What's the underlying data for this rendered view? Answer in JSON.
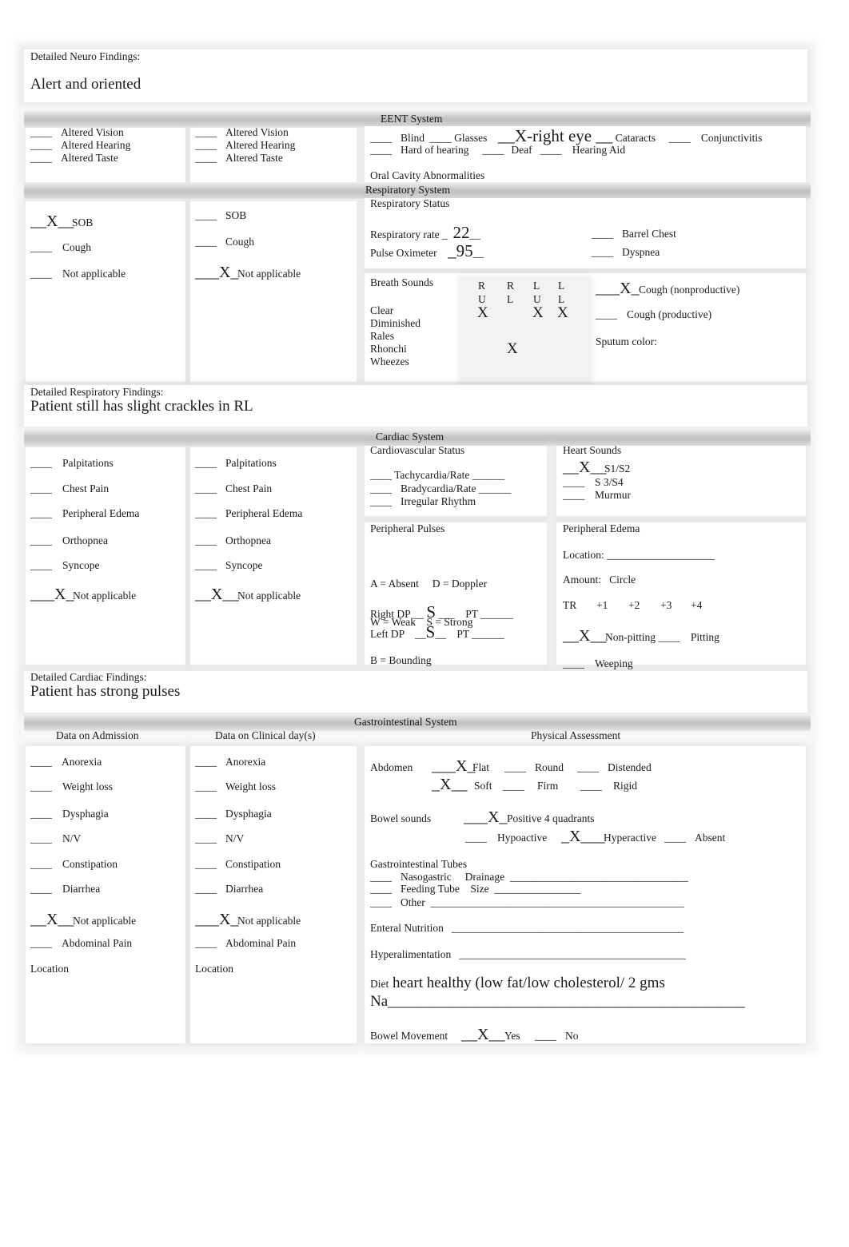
{
  "neuro": {
    "label": "Detailed Neuro Findings:",
    "value": "Alert and oriented"
  },
  "eent": {
    "title": "EENT System",
    "col1": [
      {
        "mark": "____",
        "label": "Altered Vision"
      },
      {
        "mark": "____",
        "label": "Altered Hearing"
      },
      {
        "mark": "____",
        "label": "Altered Taste"
      }
    ],
    "col2": [
      {
        "mark": "____",
        "label": "Altered Vision"
      },
      {
        "mark": "____",
        "label": "Altered Hearing"
      },
      {
        "mark": "____",
        "label": "Altered Taste"
      }
    ],
    "row1": {
      "blind_mark": "____",
      "blind": "Blind",
      "glasses_mark": "____",
      "glasses": "Glasses",
      "cataracts_mark": "__X-right eye __",
      "cataracts": "Cataracts",
      "conj_mark": "____",
      "conj": "Conjunctivitis"
    },
    "row2": {
      "hoh_mark": "____",
      "hoh": "Hard of hearing",
      "deaf_mark": "____",
      "deaf": "Deaf",
      "aid_mark": "____",
      "aid": "Hearing Aid"
    },
    "oral": "Oral Cavity Abnormalities"
  },
  "resp": {
    "title": "Respiratory System",
    "col1": [
      {
        "mark": "__X__",
        "label": "SOB"
      },
      {
        "mark": "____",
        "label": "Cough"
      },
      {
        "mark": "____",
        "label": "Not applicable"
      }
    ],
    "col2": [
      {
        "mark": "____",
        "label": "SOB"
      },
      {
        "mark": "____",
        "label": "Cough"
      },
      {
        "mark": "___X_",
        "label": "Not applicable"
      }
    ],
    "status_title": "Respiratory Status",
    "rate_label": "Respiratory rate _",
    "rate_value": "22",
    "rate_tail": "__",
    "pox_label": "Pulse Oximeter",
    "pox_value": "_95",
    "pox_tail": "__",
    "barrel_mark": "____",
    "barrel": "Barrel Chest",
    "dysp_mark": "____",
    "dysp": "Dyspnea",
    "breath_title": "Breath Sounds",
    "breath_rows": [
      "Clear",
      "Diminished",
      "Rales",
      "Rhonchi",
      "Wheezes"
    ],
    "lobes": [
      {
        "top": "R",
        "bottom": "U"
      },
      {
        "top": "R",
        "bottom": "L"
      },
      {
        "top": "L",
        "bottom": "U"
      },
      {
        "top": "L",
        "bottom": "L"
      }
    ],
    "marks": {
      "clear_ru": "X",
      "clear_lu": "X",
      "clear_ll": "X",
      "rhonchi_rl": "X"
    },
    "cough_np_mark": "___X_",
    "cough_np": "Cough (nonproductive)",
    "cough_p_mark": "____",
    "cough_p": "Cough (productive)",
    "sputum": "Sputum color:",
    "findings_label": "Detailed Respiratory Findings:",
    "findings_value": "Patient still has slight crackles in RL"
  },
  "cardiac": {
    "title": "Cardiac System",
    "col1": [
      {
        "mark": "____",
        "label": "Palpitations"
      },
      {
        "mark": "____",
        "label": "Chest Pain"
      },
      {
        "mark": "____",
        "label": "Peripheral Edema"
      },
      {
        "mark": "____",
        "label": "Orthopnea"
      },
      {
        "mark": "____",
        "label": "Syncope"
      },
      {
        "mark": "___X_",
        "label": "Not applicable"
      }
    ],
    "col2": [
      {
        "mark": "____",
        "label": "Palpitations"
      },
      {
        "mark": "____",
        "label": "Chest Pain"
      },
      {
        "mark": "____",
        "label": "Peripheral Edema"
      },
      {
        "mark": "____",
        "label": "Orthopnea"
      },
      {
        "mark": "____",
        "label": "Syncope"
      },
      {
        "mark": "__X__",
        "label": "Not applicable"
      }
    ],
    "cv_status": "Cardiovascular Status",
    "tachy": "____ Tachycardia/Rate ______",
    "brady_mark": "____",
    "brady": "Bradycardia/Rate ______",
    "irreg_mark": "____",
    "irreg": "Irregular Rhythm",
    "heart_sounds": "Heart Sounds",
    "s1s2_mark": "__X__",
    "s1s2": "S1/S2",
    "s3s4_mark": "____",
    "s3s4": "S 3/S4",
    "murmur_mark": "____",
    "murmur": "Murmur",
    "pulses_title": "Peripheral Pulses",
    "legend1": "A = Absent     D = Doppler",
    "legend2": "W = Weak    S = Strong",
    "legend3": "B = Bounding",
    "right_dp_label": "Right DP __",
    "right_dp_value": "S",
    "right_tail": "___    PT ______",
    "left_dp_label": "Left DP    __",
    "left_dp_value": "S",
    "left_tail": "__    PT ______",
    "edema_title": "Peripheral Edema",
    "location": "Location: ____________________",
    "amount": "Amount:   Circle",
    "scale": [
      "TR",
      "+1",
      "+2",
      "+3",
      "+4"
    ],
    "nonpit_mark": "__X__",
    "nonpit": "Non-pitting ____",
    "pitting": "Pitting",
    "weeping_mark": "____",
    "weeping": "Weeping",
    "findings_label": "Detailed Cardiac Findings:",
    "findings_value": "Patient has strong pulses"
  },
  "gi": {
    "title": "Gastrointestinal System",
    "col1_header": "Data on Admission",
    "col2_header": "Data on Clinical day(s)",
    "col3_header": "Physical Assessment",
    "col1": [
      {
        "mark": "____",
        "label": "Anorexia"
      },
      {
        "mark": "____",
        "label": "Weight loss"
      },
      {
        "mark": "____",
        "label": "Dysphagia"
      },
      {
        "mark": "____",
        "label": "N/V"
      },
      {
        "mark": "____",
        "label": "Constipation"
      },
      {
        "mark": "____",
        "label": "Diarrhea"
      },
      {
        "mark": "__X__",
        "label": "Not applicable"
      },
      {
        "mark": "____",
        "label": "Abdominal Pain"
      }
    ],
    "col2": [
      {
        "mark": "____",
        "label": "Anorexia"
      },
      {
        "mark": "____",
        "label": "Weight loss"
      },
      {
        "mark": "____",
        "label": "Dysphagia"
      },
      {
        "mark": "____",
        "label": "N/V"
      },
      {
        "mark": "____",
        "label": "Constipation"
      },
      {
        "mark": "____",
        "label": "Diarrhea"
      },
      {
        "mark": "___X_",
        "label": "Not applicable"
      },
      {
        "mark": "____",
        "label": "Abdominal Pain"
      }
    ],
    "location": "Location",
    "abdomen": "Abdomen",
    "flat_mark": "___X_",
    "flat": "Flat",
    "round_mark": "____",
    "round": "Round",
    "dist_mark": "____",
    "dist": "Distended",
    "soft_mark": "_X__",
    "soft": "Soft",
    "firm_mark": "____",
    "firm": "Firm",
    "rigid_mark": "____",
    "rigid": "Rigid",
    "bowel_sounds": "Bowel sounds",
    "pos4_mark": "___X_",
    "pos4": "Positive 4 quadrants",
    "hypo_mark": "____",
    "hypo": "Hypoactive",
    "hyper_mark": "_X___",
    "hyper": "Hyperactive",
    "absent_mark": "____",
    "absent": "Absent",
    "tubes_title": "Gastrointestinal Tubes",
    "ng_mark": "____",
    "ng": "Nasogastric     Drainage  _________________________________",
    "ft_mark": "____",
    "ft": "Feeding Tube    Size  ________________",
    "other_mark": "____",
    "other": "Other  _______________________________________________",
    "enteral": "Enteral Nutrition   ___________________________________________",
    "hyperal": "Hyperalimentation   __________________________________________",
    "diet_label": "Diet",
    "diet_value": "heart healthy (low fat/low cholesterol/ 2 gms",
    "diet_value2": "Na_______________________________________________",
    "bm_label": "Bowel Movement",
    "bm_yes_mark": "__X__",
    "bm_yes": "Yes",
    "bm_no_mark": "____",
    "bm_no": "No"
  }
}
